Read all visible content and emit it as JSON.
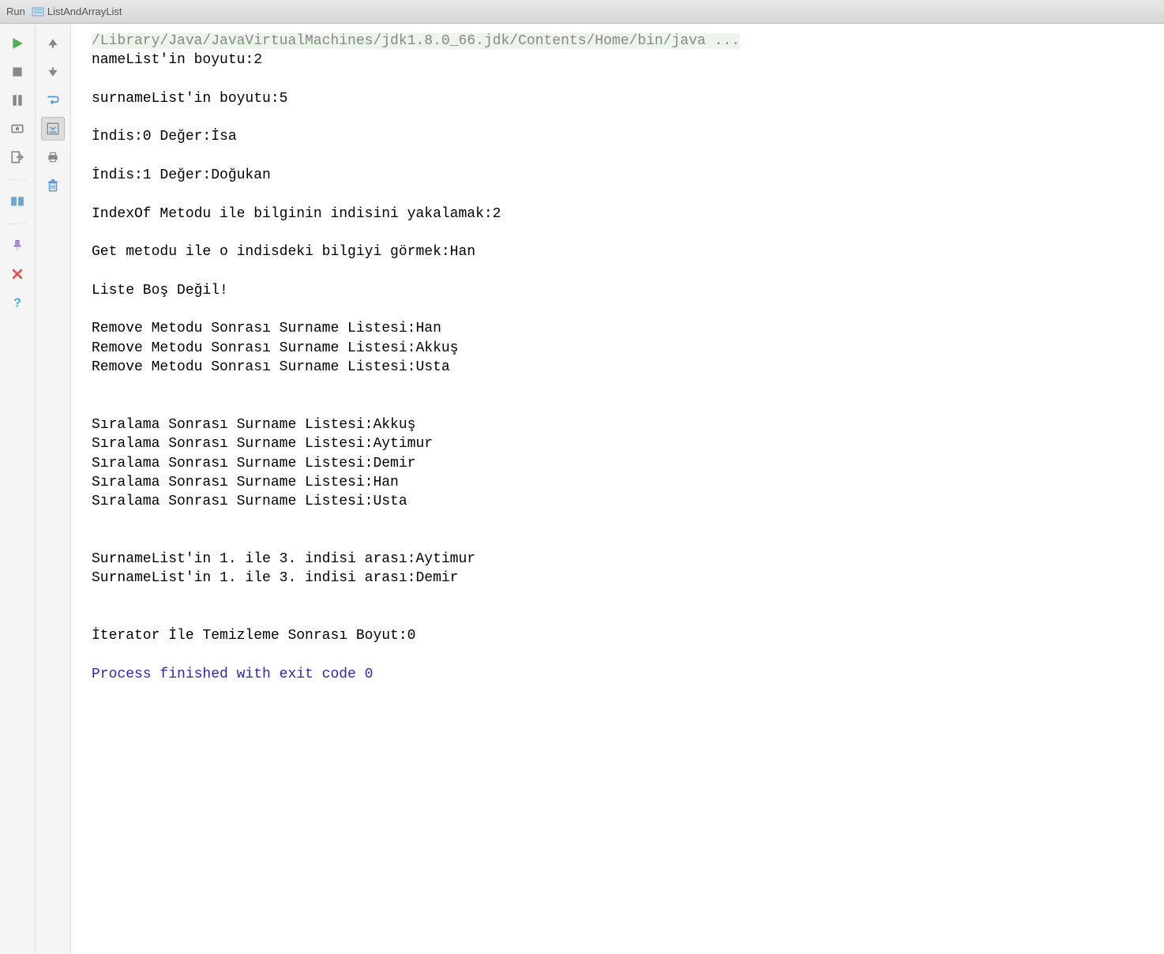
{
  "header": {
    "run_label": "Run",
    "title": "ListAndArrayList"
  },
  "console": {
    "command": "/Library/Java/JavaVirtualMachines/jdk1.8.0_66.jdk/Contents/Home/bin/java ...",
    "lines": [
      "nameList'in boyutu:2",
      "",
      "surnameList'in boyutu:5",
      "",
      "İndis:0 Değer:İsa",
      "",
      "İndis:1 Değer:Doğukan",
      "",
      "IndexOf Metodu ile bilginin indisini yakalamak:2",
      "",
      "Get metodu ile o indisdeki bilgiyi görmek:Han",
      "",
      "Liste Boş Değil!",
      "",
      "Remove Metodu Sonrası Surname Listesi:Han",
      "Remove Metodu Sonrası Surname Listesi:Akkuş",
      "Remove Metodu Sonrası Surname Listesi:Usta",
      "",
      "",
      "Sıralama Sonrası Surname Listesi:Akkuş",
      "Sıralama Sonrası Surname Listesi:Aytimur",
      "Sıralama Sonrası Surname Listesi:Demir",
      "Sıralama Sonrası Surname Listesi:Han",
      "Sıralama Sonrası Surname Listesi:Usta",
      "",
      "",
      "SurnameList'in 1. ile 3. indisi arası:Aytimur",
      "SurnameList'in 1. ile 3. indisi arası:Demir",
      "",
      "",
      "İterator İle Temizleme Sonrası Boyut:0",
      ""
    ],
    "exit": "Process finished with exit code 0"
  }
}
